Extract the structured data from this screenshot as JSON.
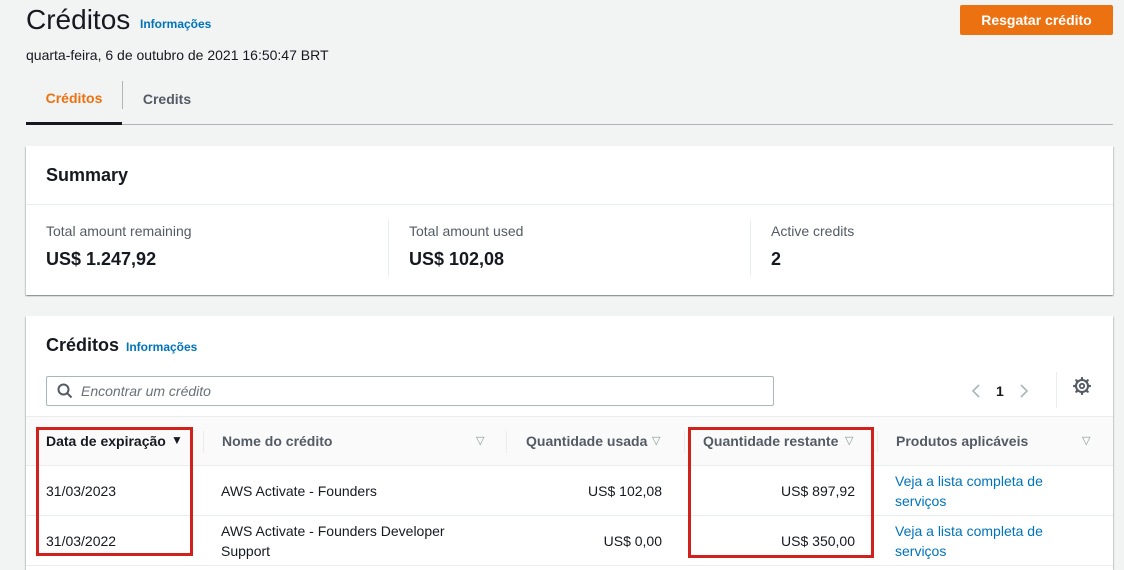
{
  "header": {
    "title": "Créditos",
    "info_link": "Informações",
    "timestamp": "quarta-feira, 6 de outubro de 2021 16:50:47 BRT",
    "redeem_button": "Resgatar crédito"
  },
  "tabs": [
    {
      "label": "Créditos",
      "active": true
    },
    {
      "label": "Credits",
      "active": false
    }
  ],
  "summary": {
    "title": "Summary",
    "stats": [
      {
        "label": "Total amount remaining",
        "value": "US$ 1.247,92"
      },
      {
        "label": "Total amount used",
        "value": "US$ 102,08"
      },
      {
        "label": "Active credits",
        "value": "2"
      }
    ]
  },
  "credits": {
    "title": "Créditos",
    "info_link": "Informações",
    "search_placeholder": "Encontrar um crédito",
    "page": "1",
    "columns": [
      {
        "label": "Data de expiração",
        "sorted": true
      },
      {
        "label": "Nome do crédito"
      },
      {
        "label": "Quantidade usada"
      },
      {
        "label": "Quantidade restante"
      },
      {
        "label": "Produtos aplicáveis"
      }
    ],
    "rows": [
      {
        "expiration": "31/03/2023",
        "name": "AWS Activate - Founders",
        "used": "US$ 102,08",
        "remaining": "US$ 897,92",
        "products_line1": "Veja a lista completa de",
        "products_line2": "serviços"
      },
      {
        "expiration": "31/03/2022",
        "name_line1": "AWS Activate - Founders Developer",
        "name_line2": "Support",
        "used": "US$ 0,00",
        "remaining": "US$ 350,00",
        "products_line1": "Veja a lista completa de",
        "products_line2": "serviços"
      }
    ]
  },
  "colors": {
    "accent": "#ec7211",
    "link": "#0073bb",
    "highlight": "#d0211c"
  }
}
